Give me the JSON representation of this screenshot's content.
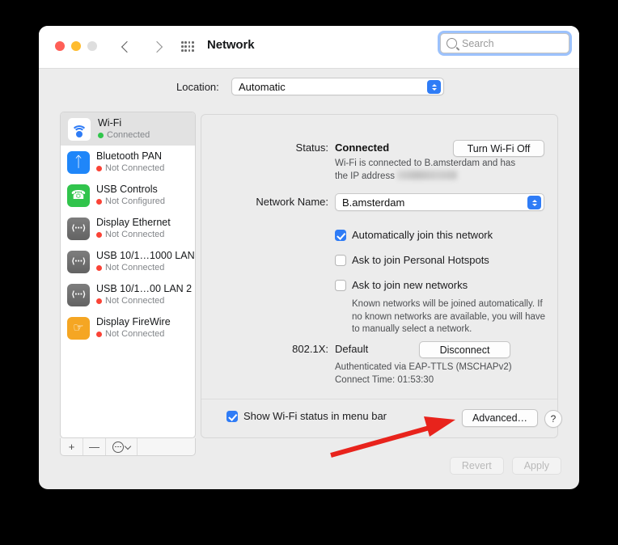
{
  "window": {
    "title": "Network",
    "traffic_lights": [
      "close",
      "minimize",
      "zoom"
    ],
    "nav": {
      "back": "back-arrow",
      "forward": "forward-arrow"
    },
    "grid_icon": "apps-grid-icon"
  },
  "search": {
    "placeholder": "Search",
    "icon": "search-icon",
    "value": ""
  },
  "location": {
    "label": "Location:",
    "value": "Automatic"
  },
  "sidebar": {
    "items": [
      {
        "name": "Wi-Fi",
        "status": "Connected",
        "status_color": "green",
        "icon": "wifi-icon",
        "selected": true
      },
      {
        "name": "Bluetooth PAN",
        "status": "Not Connected",
        "status_color": "red",
        "icon": "bluetooth-icon",
        "selected": false
      },
      {
        "name": "USB Controls",
        "status": "Not Configured",
        "status_color": "red",
        "icon": "usb-controls-icon",
        "selected": false
      },
      {
        "name": "Display Ethernet",
        "status": "Not Connected",
        "status_color": "red",
        "icon": "ethernet-icon",
        "selected": false
      },
      {
        "name": "USB 10/1…1000 LAN",
        "status": "Not Connected",
        "status_color": "red",
        "icon": "ethernet-icon",
        "selected": false
      },
      {
        "name": "USB 10/1…00 LAN 2",
        "status": "Not Connected",
        "status_color": "red",
        "icon": "ethernet-icon",
        "selected": false
      },
      {
        "name": "Display FireWire",
        "status": "Not Connected",
        "status_color": "red",
        "icon": "firewire-icon",
        "selected": false
      }
    ],
    "toolbar": {
      "add": "+",
      "remove": "—",
      "actions_icon": "actions-gear-icon"
    }
  },
  "main": {
    "status_label": "Status:",
    "status_value": "Connected",
    "toggle_button": "Turn Wi-Fi Off",
    "status_desc_line1": "Wi-Fi is connected to B.amsterdam and has",
    "status_desc_line2_prefix": "the IP address",
    "network_name_label": "Network Name:",
    "network_name_value": "B.amsterdam",
    "checkboxes": [
      {
        "label": "Automatically join this network",
        "checked": true
      },
      {
        "label": "Ask to join Personal Hotspots",
        "checked": false
      },
      {
        "label": "Ask to join new networks",
        "checked": false
      }
    ],
    "networks_help_line1": "Known networks will be joined automatically. If",
    "networks_help_line2": "no known networks are available, you will have",
    "networks_help_line3": "to manually select a network.",
    "dot1x_label": "802.1X:",
    "dot1x_value": "Default",
    "disconnect_button": "Disconnect",
    "auth_line": "Authenticated via EAP-TTLS (MSCHAPv2)",
    "connect_time_line": "Connect Time: 01:53:30",
    "show_status_checkbox": {
      "label": "Show Wi-Fi status in menu bar",
      "checked": true
    },
    "advanced_button": "Advanced…",
    "help_button": "?"
  },
  "footer": {
    "revert_button": "Revert",
    "apply_button": "Apply",
    "revert_enabled": false,
    "apply_enabled": false
  },
  "annotation": {
    "type": "red-arrow",
    "color": "#e8231c",
    "points_to": "advanced-button"
  }
}
